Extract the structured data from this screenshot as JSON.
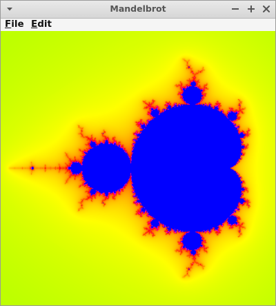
{
  "window": {
    "title": "Mandelbrot",
    "controls": [
      "minimize",
      "maximize",
      "close"
    ]
  },
  "menubar": {
    "items": [
      {
        "label": "File",
        "mnemonic": "F",
        "rest": "ile"
      },
      {
        "label": "Edit",
        "mnemonic": "E",
        "rest": "dit"
      }
    ]
  },
  "fractal": {
    "colors": {
      "set": "#0000ff",
      "outer": "#33ff00",
      "mid": "#ffff00",
      "inner": "#ff0000",
      "edge": "#ff00ff"
    }
  },
  "icons": {
    "window_menu": "chevron-down-icon",
    "minimize": "minus-icon",
    "maximize": "plus-icon",
    "close": "x-icon"
  }
}
